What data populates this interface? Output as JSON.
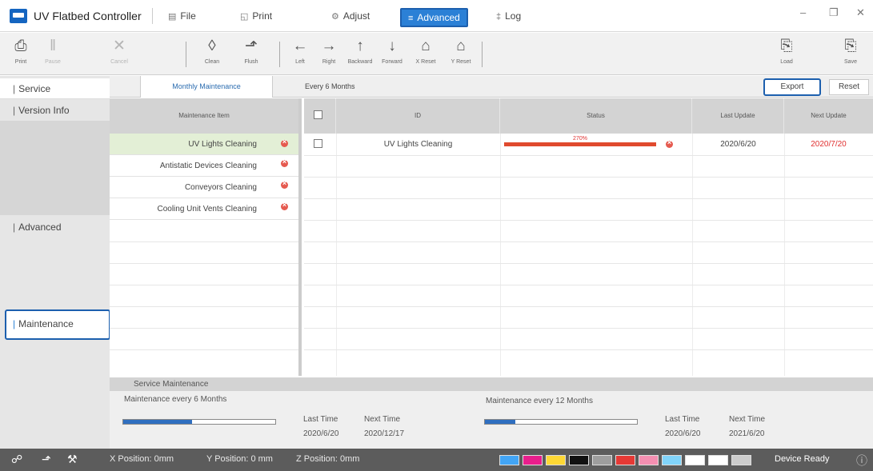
{
  "app": {
    "title": "UV Flatbed Controller"
  },
  "menu": {
    "file": "File",
    "print": "Print",
    "adjust": "Adjust",
    "advanced": "Advanced",
    "log": "Log"
  },
  "toolbar": {
    "print": "Print",
    "pause": "Pause",
    "cancel": "Cancel",
    "clean": "Clean",
    "flush": "Flush",
    "left": "Left",
    "right": "Right",
    "backward": "Backward",
    "forward": "Forward",
    "x_reset": "X Reset",
    "y_reset": "Y Reset",
    "load": "Load",
    "save": "Save"
  },
  "sidebar": {
    "service": "Service",
    "version_info": "Version Info",
    "advanced": "Advanced",
    "maintenance": "Maintenance"
  },
  "tabs": {
    "monthly": "Monthly Maintenance",
    "six_months": "Every 6 Months",
    "export": "Export",
    "reset": "Reset"
  },
  "left_list": {
    "header": "Maintenance Item",
    "items": [
      {
        "label": "UV Lights Cleaning"
      },
      {
        "label": "Antistatic Devices Cleaning"
      },
      {
        "label": "Conveyors Cleaning"
      },
      {
        "label": "Cooling Unit Vents Cleaning"
      }
    ]
  },
  "table": {
    "columns": {
      "id": "ID",
      "status": "Status",
      "last_update": "Last Update",
      "next_update": "Next Update"
    },
    "rows": [
      {
        "id": "UV Lights Cleaning",
        "status_percent": "270%",
        "last_update": "2020/6/20",
        "next_update": "2020/7/20"
      }
    ]
  },
  "service_maintenance": {
    "header": "Service Maintenance",
    "six_months": {
      "label": "Maintenance every 6 Months",
      "last_time_label": "Last Time",
      "next_time_label": "Next Time",
      "last_time": "2020/6/20",
      "next_time": "2020/12/17",
      "progress": 0.45
    },
    "twelve_months": {
      "label": "Maintenance every 12 Months",
      "last_time_label": "Last Time",
      "next_time_label": "Next Time",
      "last_time": "2020/6/20",
      "next_time": "2021/6/20",
      "progress": 0.2
    }
  },
  "status_bar": {
    "x_position": "X Position: 0mm",
    "y_position": "Y Position: 0 mm",
    "z_position": "Z Position: 0mm",
    "state": "Device Ready"
  },
  "colors": {
    "accent": "#2b80d6",
    "error": "#e55a4f",
    "due": "#e03030",
    "status_bar": "#5c5c5c",
    "ink_swatches": [
      "#42a5f5",
      "#e91e8c",
      "#fdd835",
      "#111111",
      "#9e9e9e",
      "#e53935",
      "#f48fb1",
      "#81d4fa",
      "#ffffff",
      "#ffffff",
      "#cccccc"
    ]
  }
}
